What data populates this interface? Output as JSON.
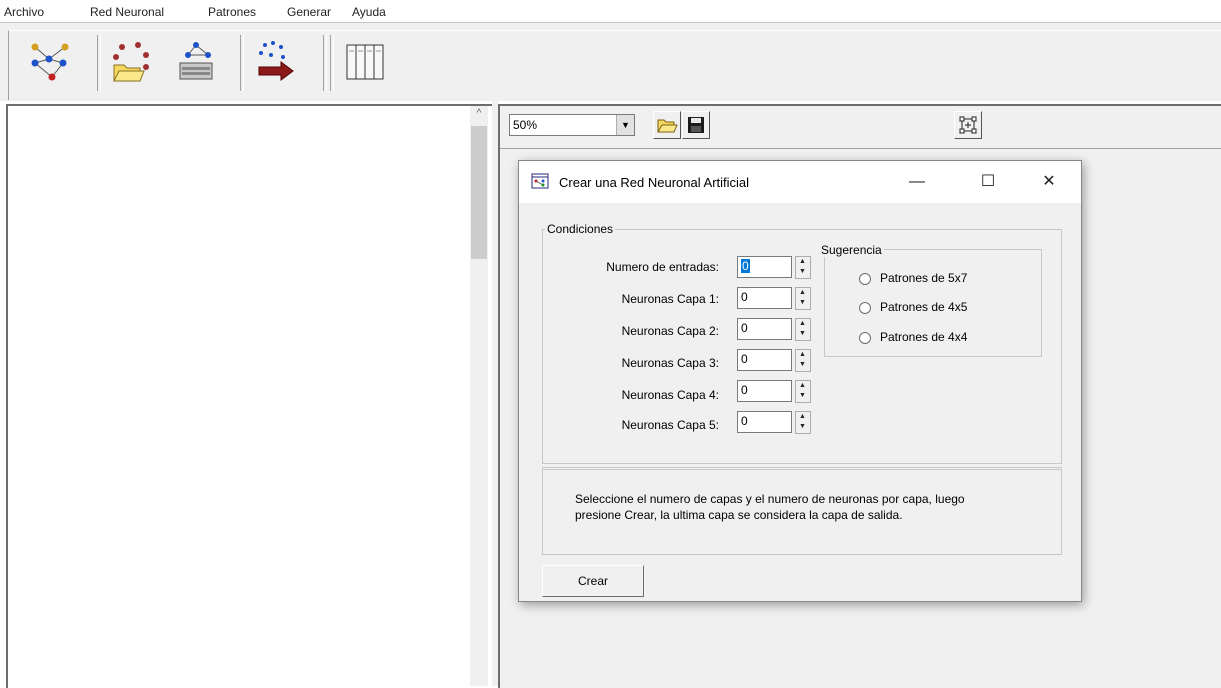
{
  "menubar": {
    "items": [
      "Archivo",
      "Red Neuronal",
      "Patrones",
      "Generar",
      "Ayuda"
    ]
  },
  "toolbar": {
    "buttons": [
      "network-icon",
      "open-network-icon",
      "network-device-icon",
      "generate-arrow-icon",
      "grid-view-icon"
    ]
  },
  "right_toolbar": {
    "zoom_value": "50%",
    "buttons": [
      "open-folder-icon",
      "save-disk-icon",
      "fit-view-icon"
    ]
  },
  "dialog": {
    "title": "Crear una Red Neuronal Artificial",
    "minimize": "—",
    "maximize": "☐",
    "close": "✕",
    "conditions_group": "Condiciones",
    "rows": [
      {
        "label": "Numero de entradas:",
        "value": "0"
      },
      {
        "label": "Neuronas Capa 1:",
        "value": "0"
      },
      {
        "label": "Neuronas Capa 2:",
        "value": "0"
      },
      {
        "label": "Neuronas Capa 3:",
        "value": "0"
      },
      {
        "label": "Neuronas Capa 4:",
        "value": "0"
      },
      {
        "label": "Neuronas Capa 5:",
        "value": "0"
      }
    ],
    "suggestion_group": "Sugerencia",
    "suggestions": [
      "Patrones de 5x7",
      "Patrones de 4x5",
      "Patrones de 4x4"
    ],
    "message_line1": "Seleccione el numero de capas y el numero de neuronas por capa, luego",
    "message_line2": "presione Crear, la ultima capa se considera la capa de salida.",
    "create_button": "Crear"
  },
  "colors": {
    "selection": "#0078d7",
    "face": "#f0f0f0"
  }
}
